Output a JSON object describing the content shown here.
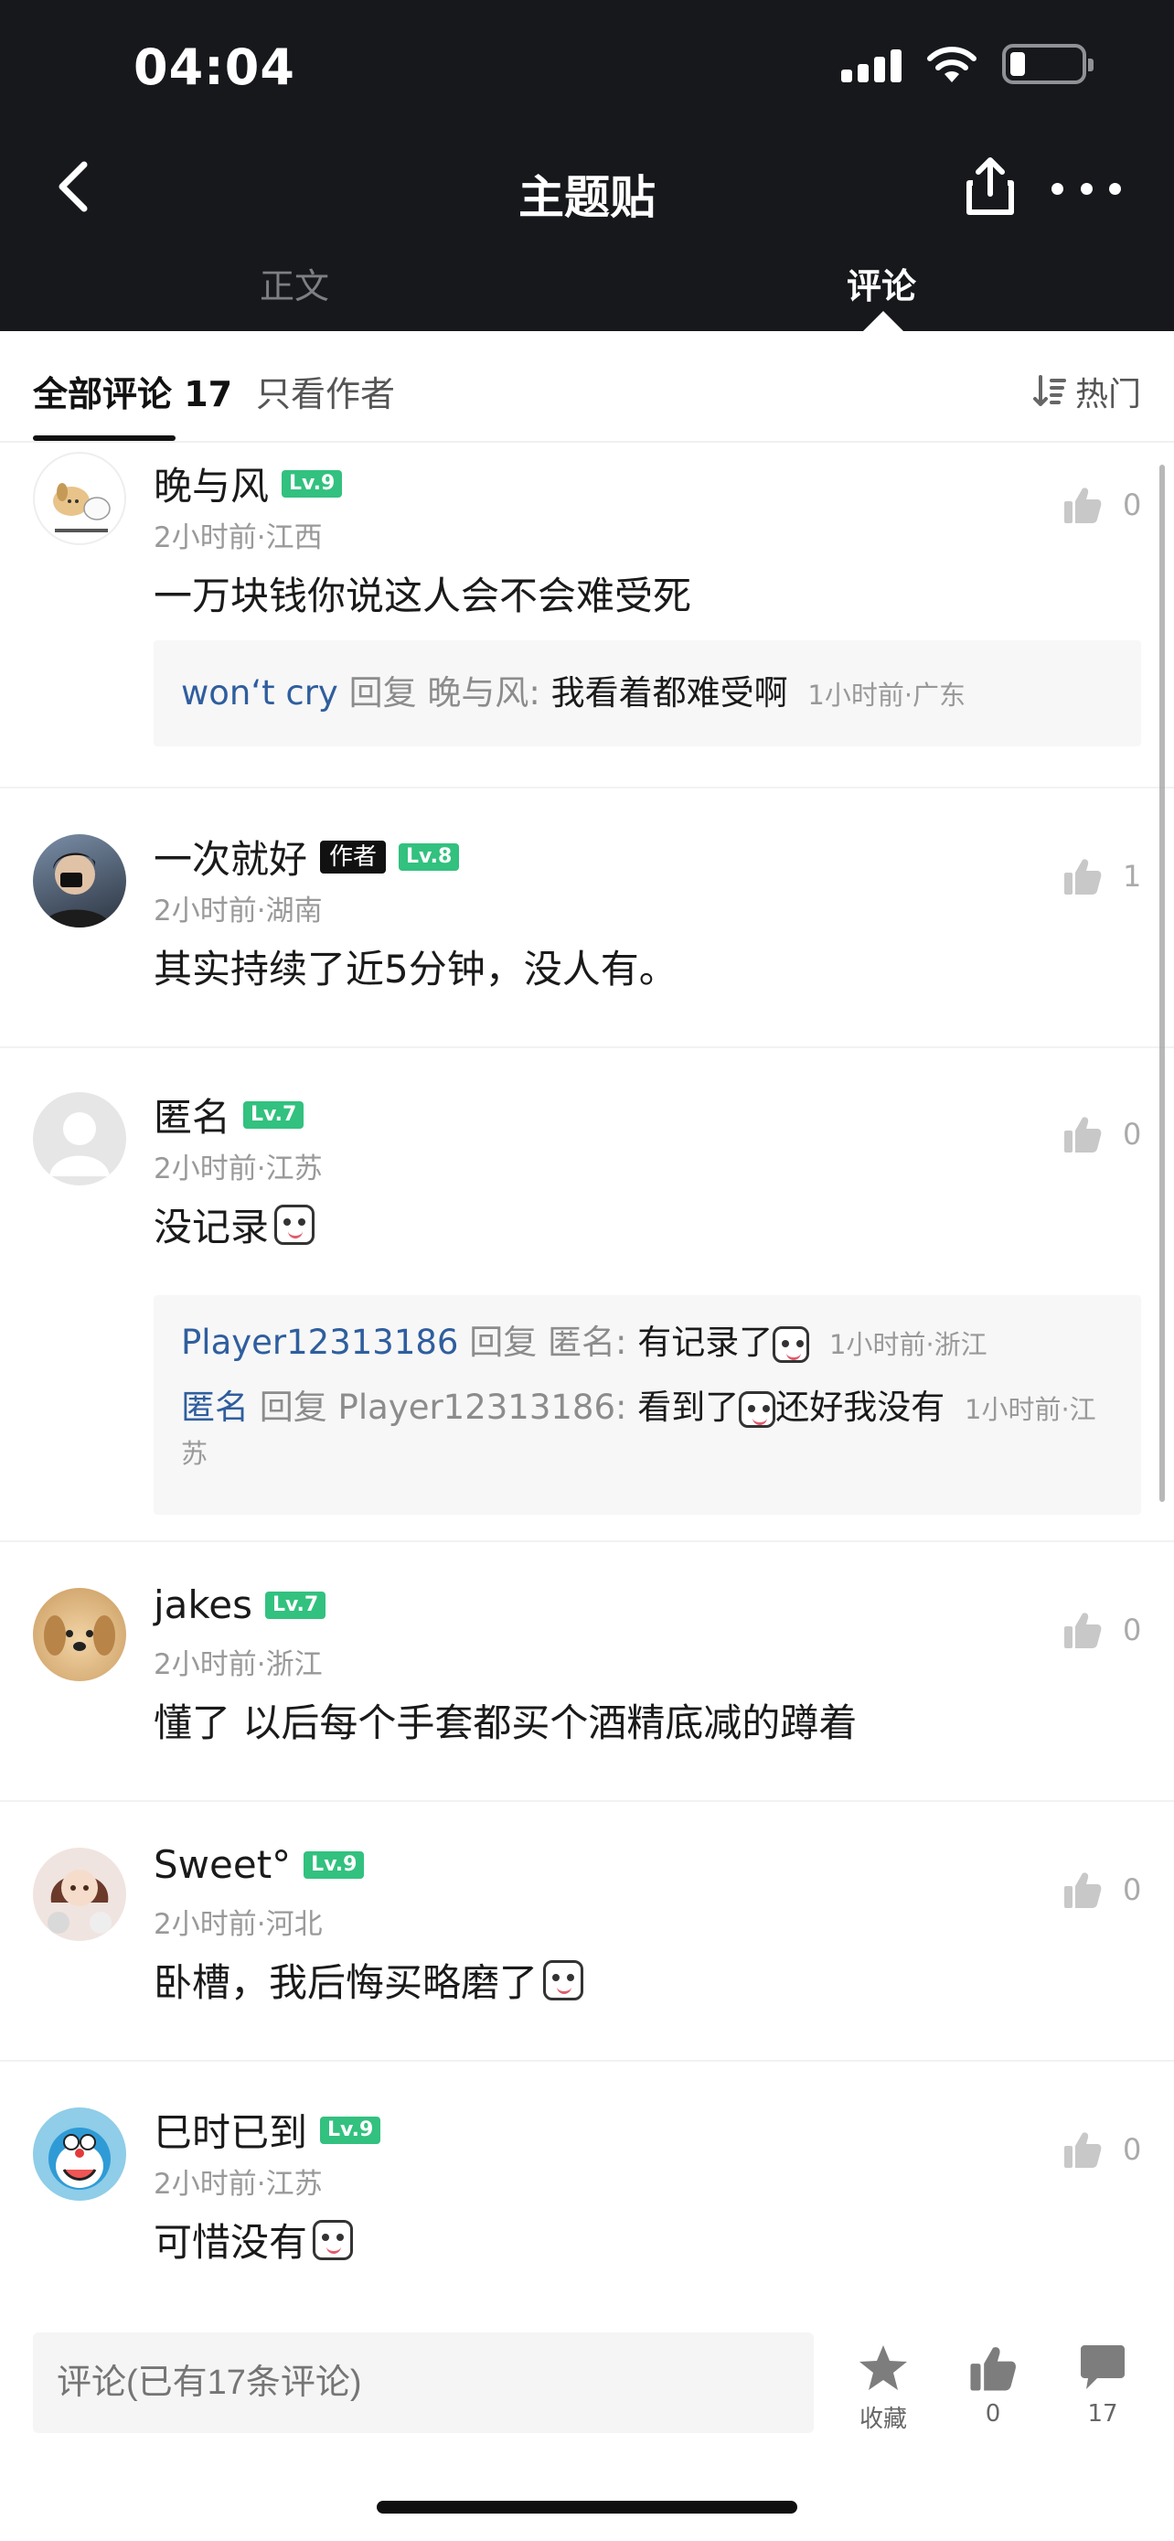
{
  "status_bar": {
    "time": "04:04"
  },
  "nav": {
    "title": "主题贴",
    "back_icon": "back-chevron-icon",
    "share_icon": "share-icon",
    "more_icon": "more-icon"
  },
  "tabs": [
    {
      "label": "正文",
      "active": false
    },
    {
      "label": "评论",
      "active": true
    }
  ],
  "filter": {
    "all_label": "全部评论 17",
    "author_only": "只看作者",
    "sort_label": "热门"
  },
  "comments": [
    {
      "name": "晚与风",
      "level": "Lv.9",
      "meta": "2小时前·江西",
      "text": "一万块钱你说这人会不会难受死",
      "likes": "0",
      "replies": [
        {
          "user": "won‘t cry",
          "reply_word": "回复",
          "target": "晚与风:",
          "text": "我看着都难受啊",
          "time": "1小时前·广东"
        }
      ]
    },
    {
      "name": "一次就好",
      "author_tag": "作者",
      "level": "Lv.8",
      "meta": "2小时前·湖南",
      "text": "其实持续了近5分钟，没人有。",
      "likes": "1"
    },
    {
      "name": "匿名",
      "level": "Lv.7",
      "meta": "2小时前·江苏",
      "text": "没记录",
      "likes": "0",
      "replies": [
        {
          "user": "Player12313186",
          "reply_word": "回复",
          "target": "匿名:",
          "text": "有记录了",
          "time": "1小时前·浙江"
        },
        {
          "user": "匿名",
          "reply_word": "回复",
          "target": "Player12313186:",
          "text_before": "看到了",
          "text_after": "还好我没有",
          "time": "1小时前·江苏"
        }
      ]
    },
    {
      "name": "jakes",
      "level": "Lv.7",
      "meta": "2小时前·浙江",
      "text": "懂了 以后每个手套都买个酒精底减的蹲着",
      "likes": "0"
    },
    {
      "name": "Sweet°",
      "level": "Lv.9",
      "meta": "2小时前·河北",
      "text": "卧槽，我后悔买略磨了",
      "likes": "0"
    },
    {
      "name": "巳时已到",
      "level": "Lv.9",
      "meta": "2小时前·江苏",
      "text": "可惜没有",
      "likes": "0"
    }
  ],
  "bottom_bar": {
    "input_placeholder": "评论(已有17条评论)",
    "favorite_label": "收藏",
    "like_count": "0",
    "comment_count": "17"
  },
  "colors": {
    "header_bg": "#16181c",
    "level_badge": "#32c17f",
    "reply_user": "#2f5e9e"
  }
}
